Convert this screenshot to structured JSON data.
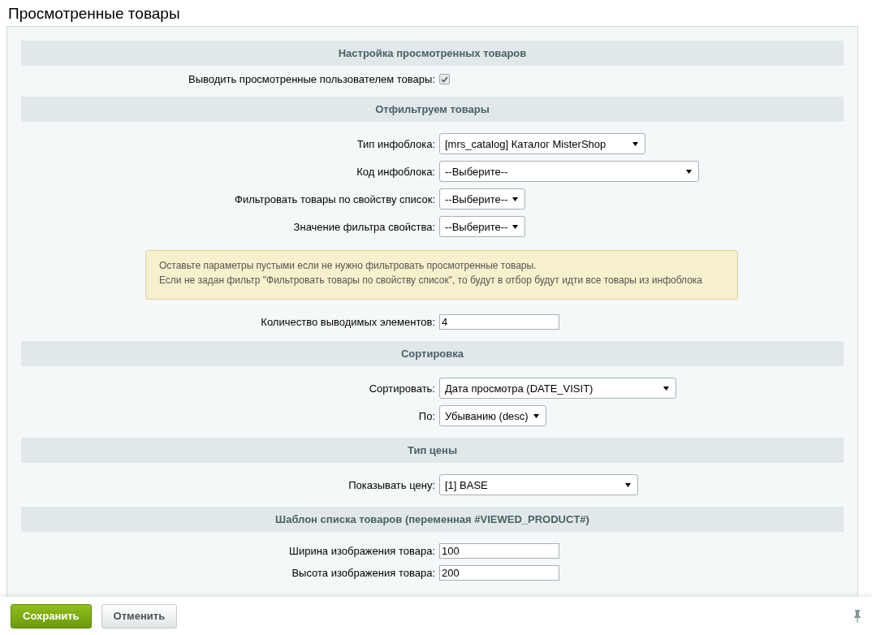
{
  "title": "Просмотренные товары",
  "rows": [
    {
      "kind": "header",
      "text": "Настройка просмотренных товаров"
    },
    {
      "kind": "checkbox",
      "label": "Выводить просмотренные пользователем товары:",
      "checked": true
    },
    {
      "kind": "header",
      "text": "Отфильтруем товары"
    },
    {
      "kind": "select",
      "label": "Тип инфоблока:",
      "value": "[mrs_catalog] Каталог MisterShop"
    },
    {
      "kind": "select",
      "label": "Код инфоблока:",
      "value": "--Выберите--"
    },
    {
      "kind": "select",
      "label": "Фильтровать товары по свойству список:",
      "value": "--Выберите--"
    },
    {
      "kind": "select",
      "label": "Значение фильтра свойства:",
      "value": "--Выберите--"
    },
    {
      "kind": "note",
      "lines": [
        "Оставьте параметры пустыми если не нужно фильтровать просмотренные товары.",
        "Если не задан фильтр \"Фильтровать товары по свойству список\", то будут в отбор будут идти все товары из инфоблока"
      ]
    },
    {
      "kind": "input",
      "label": "Количество выводимых элементов:",
      "value": "4"
    },
    {
      "kind": "header",
      "text": "Сортировка"
    },
    {
      "kind": "select",
      "label": "Сортировать:",
      "value": "Дата просмотра (DATE_VISIT)"
    },
    {
      "kind": "select",
      "label": "По:",
      "value": "Убыванию (desc)"
    },
    {
      "kind": "header",
      "text": "Тип цены"
    },
    {
      "kind": "select",
      "label": "Показывать цену:",
      "value": "[1] BASE"
    },
    {
      "kind": "header",
      "text": "Шаблон списка товаров (переменная #VIEWED_PRODUCT#)"
    },
    {
      "kind": "input",
      "label": "Ширина изображения товара:",
      "value": "100"
    },
    {
      "kind": "input",
      "label": "Высота изображения товара:",
      "value": "200"
    }
  ],
  "buttons": [
    {
      "kind": "primary",
      "label": "Сохранить"
    },
    {
      "kind": "secondary",
      "label": "Отменить"
    }
  ]
}
